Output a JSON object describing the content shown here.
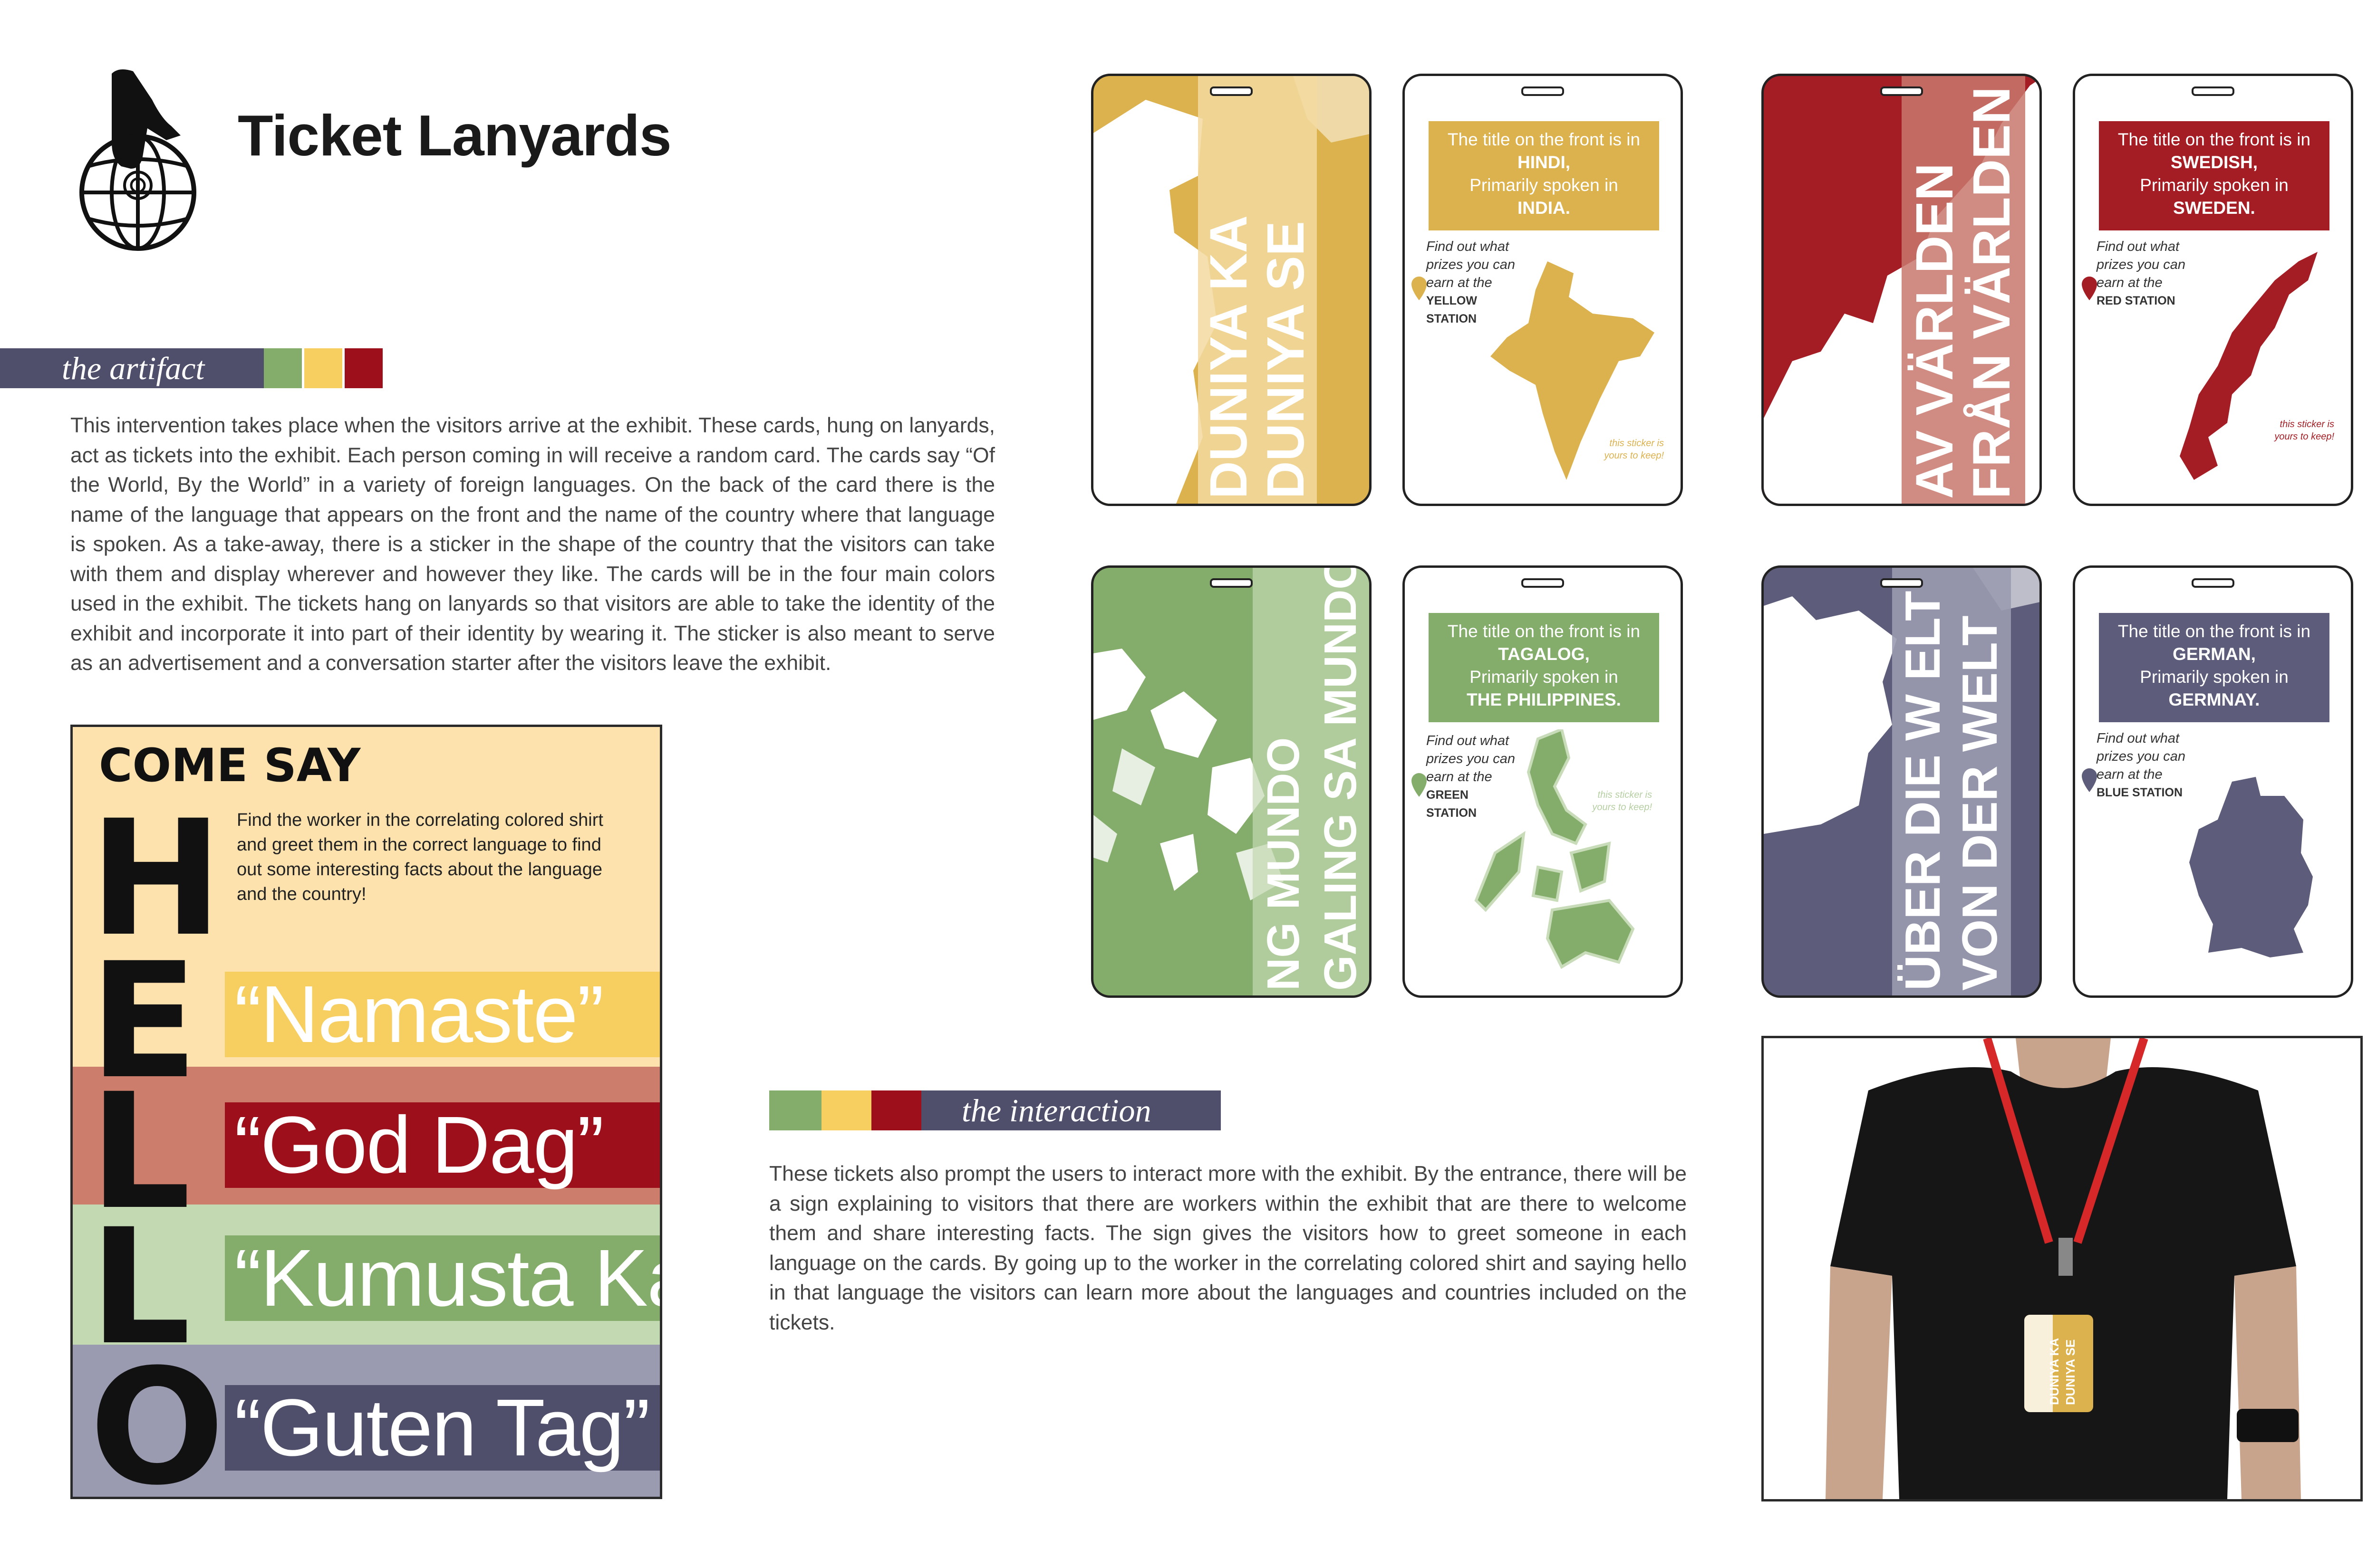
{
  "header": {
    "title": "Ticket Lanyards",
    "logo_icon": "hand-pointing-globe-icon"
  },
  "colors": {
    "navy": "#4f4f6b",
    "green": "#84ad6b",
    "yellow": "#f7cf60",
    "red": "#9d0f1a",
    "mustard": "#dcb24e",
    "cardred": "#a51d24",
    "slate": "#5d5c7a"
  },
  "artifact": {
    "label": "the artifact",
    "body": "This intervention takes place when the visitors arrive at the exhibit. These cards, hung on lanyards, act as tickets into the exhibit. Each person coming in will receive a random card. The cards say “Of the World, By the World” in a variety of foreign languages. On the back of the card there is the name of the language that appears on the front and the name of the country where that language is spoken. As a take-away, there is a sticker in the shape of the country that the visitors can take with them and display wherever and however they like. The cards will be in the four main colors used in the exhibit. The tickets hang on lanyards so that visitors are able to take the identity of the exhibit and incorporate it into part of their identity by wearing it. The sticker is also meant to serve as an advertisement and a conversation starter after the visitors leave the exhibit."
  },
  "poster": {
    "heading": "COME SAY",
    "letters": [
      "H",
      "E",
      "L",
      "L",
      "O"
    ],
    "instruction": "Find the worker in the correlating colored shirt and greet them in the correct language to find out some interesting facts about the language and the country!",
    "greetings": [
      "“Namaste”",
      "“God Dag”",
      "“Kumusta Ka”",
      "“Guten Tag”"
    ]
  },
  "interaction": {
    "label": "the interaction",
    "body": "These tickets also prompt the users to interact more with the exhibit. By the entrance, there will be a sign explaining to visitors that there are workers within the exhibit that are there to welcome them and share interesting facts. The sign gives the visitors how to greet someone in each language on the cards. By going up to the worker in the correlating colored shirt and saying hello in that language the visitors can learn more about the languages and countries included on the tickets."
  },
  "cards": [
    {
      "front_line1": "DUNIYA KA",
      "front_line2": "DUNIYA SE",
      "back_intro": "The title on the front is in",
      "language": "HINDI,",
      "spoken_in": "Primarily spoken in",
      "country": "INDIA.",
      "find_out": "Find out what prizes you can earn at the",
      "station": "YELLOW STATION",
      "sticker_note": "this sticker is yours to keep!"
    },
    {
      "front_line1": "AV VÄRLDEN",
      "front_line2": "FRÅN VÄRLDEN",
      "back_intro": "The title on the front is in",
      "language": "SWEDISH,",
      "spoken_in": "Primarily spoken in",
      "country": "SWEDEN.",
      "find_out": "Find out what prizes you can earn at the",
      "station": "RED STATION",
      "sticker_note": "this sticker is yours to keep!"
    },
    {
      "front_line1": "NG MUNDO",
      "front_line2": "GALING SA MUNDO",
      "back_intro": "The title on the front is in",
      "language": "TAGALOG,",
      "spoken_in": "Primarily spoken in",
      "country": "THE PHILIPPINES.",
      "find_out": "Find out what prizes you can earn at the",
      "station": "GREEN STATION",
      "sticker_note": "this sticker is yours to keep!"
    },
    {
      "front_line1": "ÜBER DIE W ELT",
      "front_line2": "VON DER WELT",
      "back_intro": "The title on the front is in",
      "language": "GERMAN,",
      "spoken_in": "Primarily spoken in",
      "country": "GERMNAY.",
      "find_out": "Find out what prizes you can earn at the",
      "station": "BLUE STATION"
    }
  ],
  "photo": {
    "badge_line1": "DUNIYA KA",
    "badge_line2": "DUNIYA SE"
  }
}
